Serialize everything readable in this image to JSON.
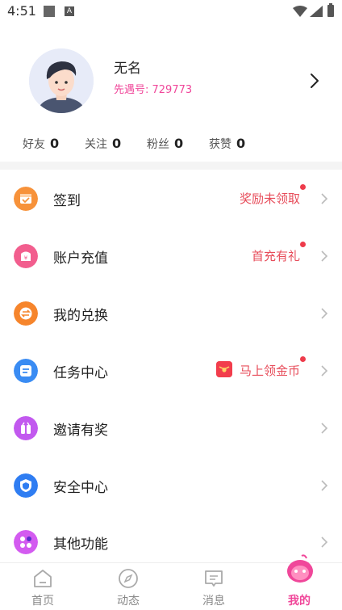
{
  "status_bar": {
    "time": "4:51",
    "a_icon": "A"
  },
  "profile": {
    "name": "无名",
    "id_text": "先遇号: 729773"
  },
  "stats": [
    {
      "label": "好友",
      "value": "0"
    },
    {
      "label": "关注",
      "value": "0"
    },
    {
      "label": "粉丝",
      "value": "0"
    },
    {
      "label": "获赞",
      "value": "0"
    }
  ],
  "menu": [
    {
      "label": "签到",
      "right": "奖励未领取",
      "dot": true,
      "icon": "checkin-calendar-icon",
      "color": "#f7923a"
    },
    {
      "label": "账户充值",
      "right": "首充有礼",
      "dot": true,
      "icon": "wallet-icon",
      "color": "#f25e8e"
    },
    {
      "label": "我的兑换",
      "right": "",
      "dot": false,
      "icon": "exchange-icon",
      "color": "#f6852c"
    },
    {
      "label": "任务中心",
      "right": "马上领金币",
      "dot": true,
      "icon": "task-list-icon",
      "color": "#3a8cf3"
    },
    {
      "label": "邀请有奖",
      "right": "",
      "dot": false,
      "icon": "gift-icon",
      "color": "#c259ef"
    },
    {
      "label": "安全中心",
      "right": "",
      "dot": false,
      "icon": "shield-icon",
      "color": "#2f7df2"
    },
    {
      "label": "其他功能",
      "right": "",
      "dot": false,
      "icon": "apps-icon",
      "color": "#d35bf0"
    }
  ],
  "bottom_nav": [
    {
      "label": "首页",
      "icon": "home-icon",
      "active": false
    },
    {
      "label": "动态",
      "icon": "compass-icon",
      "active": false
    },
    {
      "label": "消息",
      "icon": "message-icon",
      "active": false
    },
    {
      "label": "我的",
      "icon": "mascot-icon",
      "active": true
    }
  ],
  "colors": {
    "accent": "#f0479a",
    "highlight_text": "#e74c5a",
    "dot": "#ee3b4b"
  }
}
